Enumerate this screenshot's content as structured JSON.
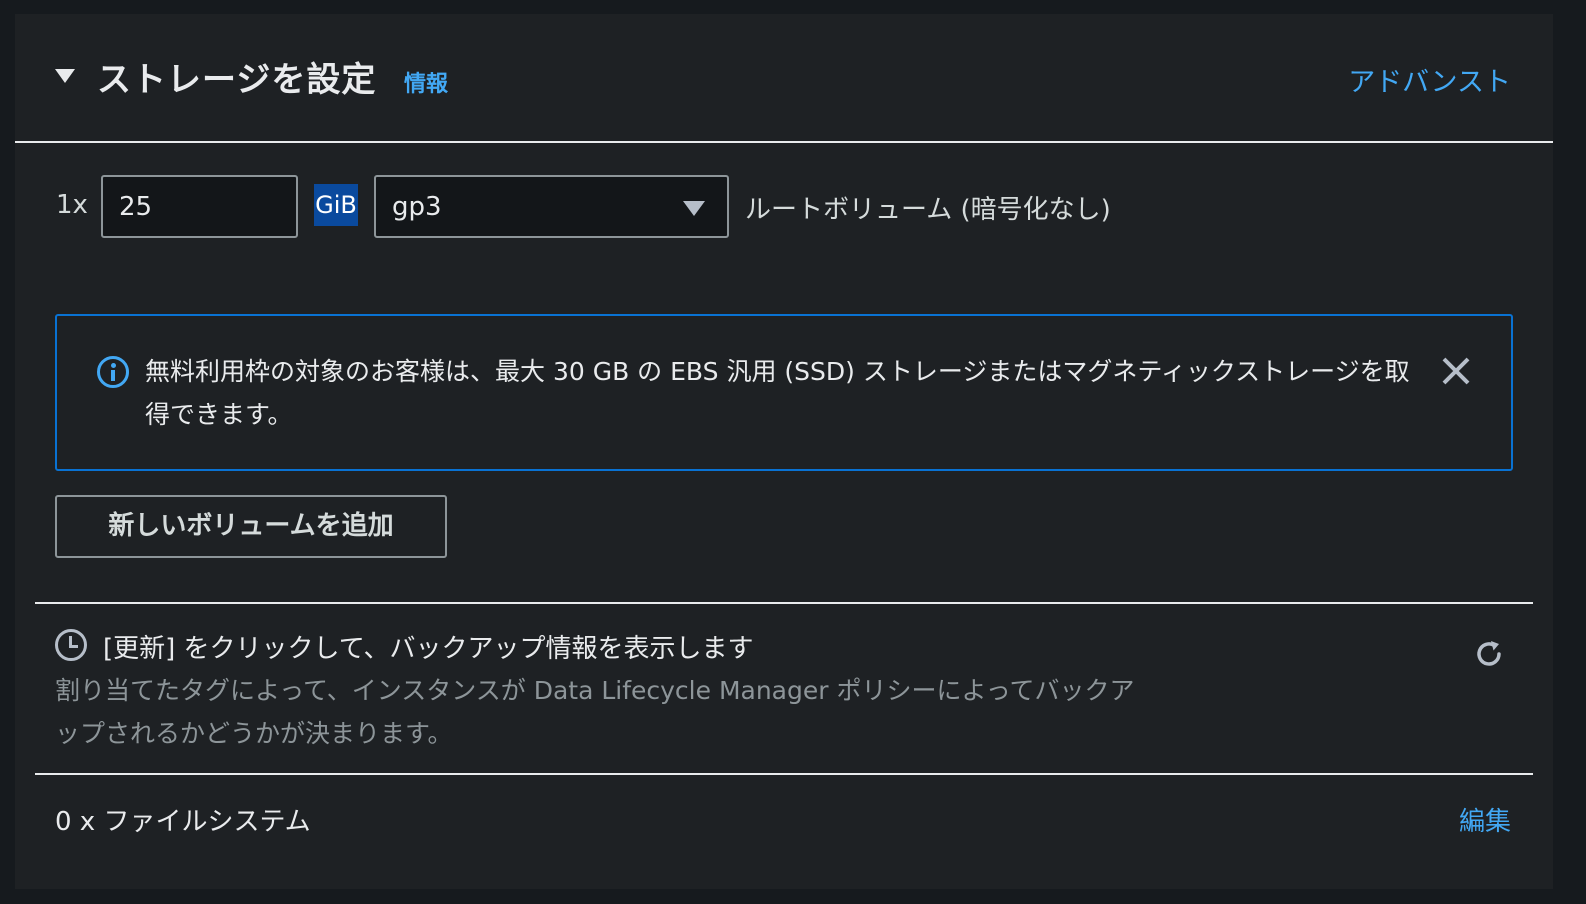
{
  "section": {
    "title": "ストレージを設定",
    "info_link": "情報",
    "advanced_link": "アドバンスト"
  },
  "volume": {
    "count_label": "1x",
    "size_value": "25",
    "unit": "GiB",
    "type_selected": "gp3",
    "description": "ルートボリューム  (暗号化なし)"
  },
  "alert": {
    "text": "無料利用枠の対象のお客様は、最大 30 GB の EBS 汎用 (SSD) ストレージまたはマグネティックストレージを取得できます。"
  },
  "add_volume_button": "新しいボリュームを追加",
  "backup": {
    "title": "[更新] をクリックして、バックアップ情報を表示します",
    "description": "割り当てたタグによって、インスタンスが Data Lifecycle Manager ポリシーによってバックアップされるかどうかが決まります。"
  },
  "file_systems": {
    "label": "0 x ファイルシステム",
    "edit_link": "編集"
  },
  "colors": {
    "accent": "#42a8f4",
    "alert_border": "#0972d3",
    "unit_badge": "#0a4a9e",
    "background": "#1e2124"
  }
}
